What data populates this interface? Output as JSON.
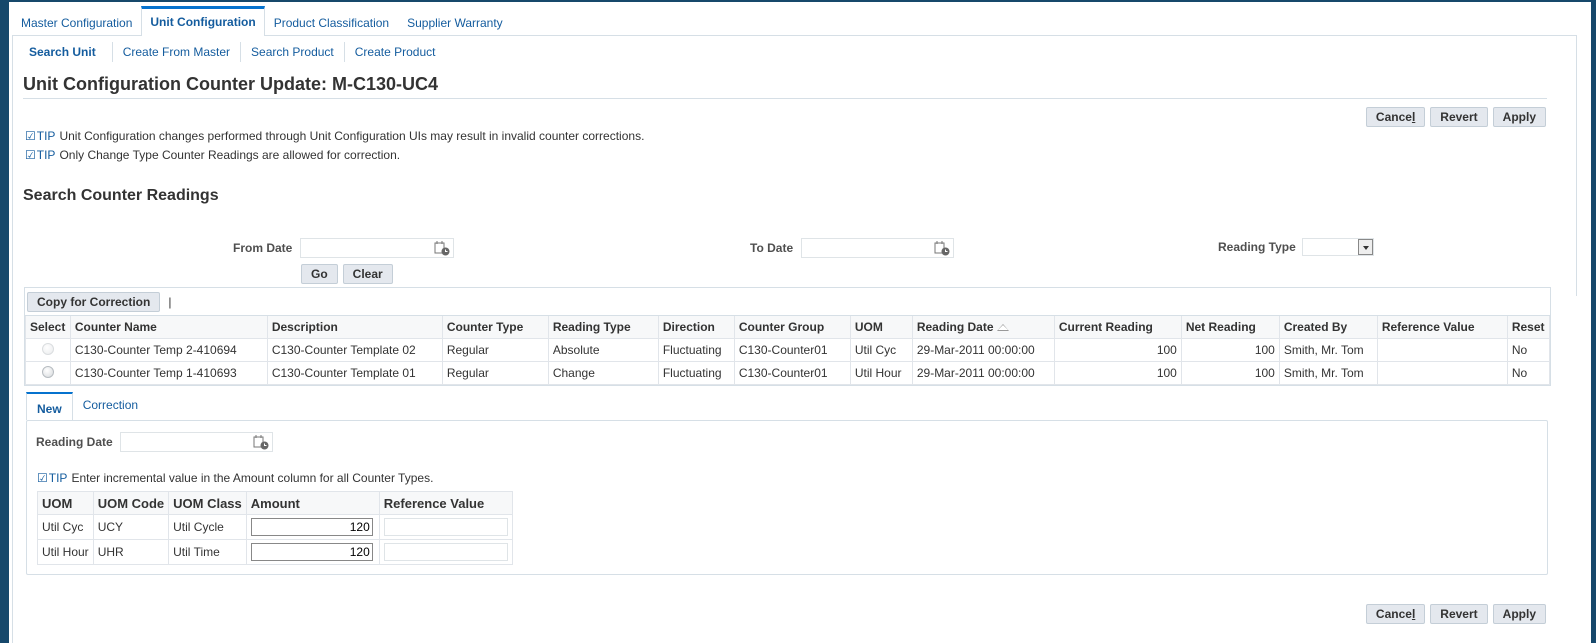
{
  "main_tabs": [
    {
      "label": "Master Configuration",
      "active": false
    },
    {
      "label": "Unit Configuration",
      "active": true
    },
    {
      "label": "Product Classification",
      "active": false
    },
    {
      "label": "Supplier Warranty",
      "active": false
    }
  ],
  "sub_tabs": [
    {
      "label": "Search Unit",
      "active": true
    },
    {
      "label": "Create From Master",
      "active": false
    },
    {
      "label": "Search Product",
      "active": false
    },
    {
      "label": "Create Product",
      "active": false
    }
  ],
  "page_title": "Unit Configuration Counter Update: M-C130-UC4",
  "actions": {
    "cancel": "Cancel",
    "revert": "Revert",
    "apply": "Apply"
  },
  "tips": [
    {
      "label": "TIP",
      "text": "Unit Configuration changes performed through Unit Configuration UIs may result in invalid counter corrections."
    },
    {
      "label": "TIP",
      "text": "Only Change Type Counter Readings are allowed for correction."
    }
  ],
  "search": {
    "title": "Search Counter Readings",
    "from_date_label": "From Date",
    "from_date_value": "",
    "to_date_label": "To Date",
    "to_date_value": "",
    "reading_type_label": "Reading Type",
    "reading_type_value": "",
    "go": "Go",
    "clear": "Clear"
  },
  "results": {
    "copy_button": "Copy for Correction",
    "separator": "|",
    "columns": [
      "Select",
      "Counter Name",
      "Description",
      "Counter Type",
      "Reading Type",
      "Direction",
      "Counter Group",
      "UOM",
      "Reading Date",
      "Current Reading",
      "Net Reading",
      "Created By",
      "Reference Value",
      "Reset"
    ],
    "rows": [
      {
        "counter_name": "C130-Counter Temp 2-410694",
        "description": "C130-Counter Template 02",
        "counter_type": "Regular",
        "reading_type": "Absolute",
        "direction": "Fluctuating",
        "counter_group": "C130-Counter01",
        "uom": "Util Cyc",
        "reading_date": "29-Mar-2011 00:00:00",
        "current_reading": "100",
        "net_reading": "100",
        "created_by": "Smith, Mr. Tom",
        "reference_value": "",
        "reset": "No",
        "select_disabled": true
      },
      {
        "counter_name": "C130-Counter Temp 1-410693",
        "description": "C130-Counter Template 01",
        "counter_type": "Regular",
        "reading_type": "Change",
        "direction": "Fluctuating",
        "counter_group": "C130-Counter01",
        "uom": "Util Hour",
        "reading_date": "29-Mar-2011 00:00:00",
        "current_reading": "100",
        "net_reading": "100",
        "created_by": "Smith, Mr. Tom",
        "reference_value": "",
        "reset": "No",
        "select_disabled": false
      }
    ]
  },
  "panel_tabs": [
    {
      "label": "New",
      "active": true
    },
    {
      "label": "Correction",
      "active": false
    }
  ],
  "new_panel": {
    "reading_date_label": "Reading Date",
    "reading_date_value": "",
    "tip_label": "TIP",
    "tip_text": "Enter incremental value in the Amount column for all Counter Types.",
    "columns": [
      "UOM",
      "UOM Code",
      "UOM Class",
      "Amount",
      "Reference Value"
    ],
    "rows": [
      {
        "uom": "Util Cyc",
        "uom_code": "UCY",
        "uom_class": "Util Cycle",
        "amount": "120",
        "reference_value": ""
      },
      {
        "uom": "Util Hour",
        "uom_code": "UHR",
        "uom_class": "Util Time",
        "amount": "120",
        "reference_value": ""
      }
    ]
  }
}
